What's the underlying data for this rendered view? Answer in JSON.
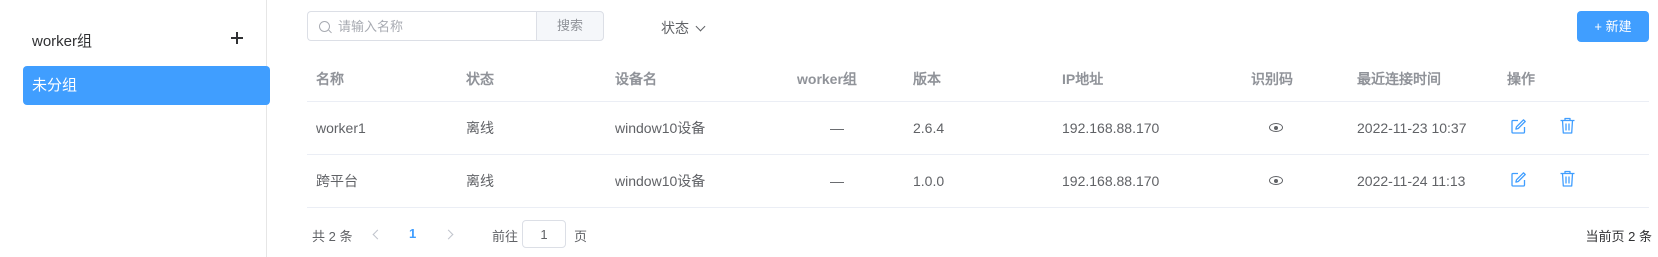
{
  "sidebar": {
    "title": "worker组",
    "add_icon": "plus-icon",
    "items": [
      {
        "label": "未分组",
        "active": true
      }
    ]
  },
  "toolbar": {
    "search_placeholder": "请输入名称",
    "search_value": "",
    "search_button": "搜索",
    "status_filter": "状态",
    "new_button": "+ 新建"
  },
  "table": {
    "columns": [
      "名称",
      "状态",
      "设备名",
      "worker组",
      "版本",
      "IP地址",
      "识别码",
      "最近连接时间",
      "操作"
    ],
    "rows": [
      {
        "name": "worker1",
        "status": "离线",
        "device": "window10设备",
        "group": "—",
        "version": "2.6.4",
        "ip": "192.168.88.170",
        "code_icon": "eye-icon",
        "last_conn": "2022-11-23 10:37"
      },
      {
        "name": "跨平台",
        "status": "离线",
        "device": "window10设备",
        "group": "—",
        "version": "1.0.0",
        "ip": "192.168.88.170",
        "code_icon": "eye-icon",
        "last_conn": "2022-11-24 11:13"
      }
    ]
  },
  "pagination": {
    "total": "共 2 条",
    "current_page": "1",
    "goto_label": "前往",
    "goto_value": "1",
    "goto_unit": "页",
    "current_count": "当前页 2 条"
  },
  "colors": {
    "primary": "#409eff",
    "border": "#ebeef5",
    "text": "#606266"
  }
}
